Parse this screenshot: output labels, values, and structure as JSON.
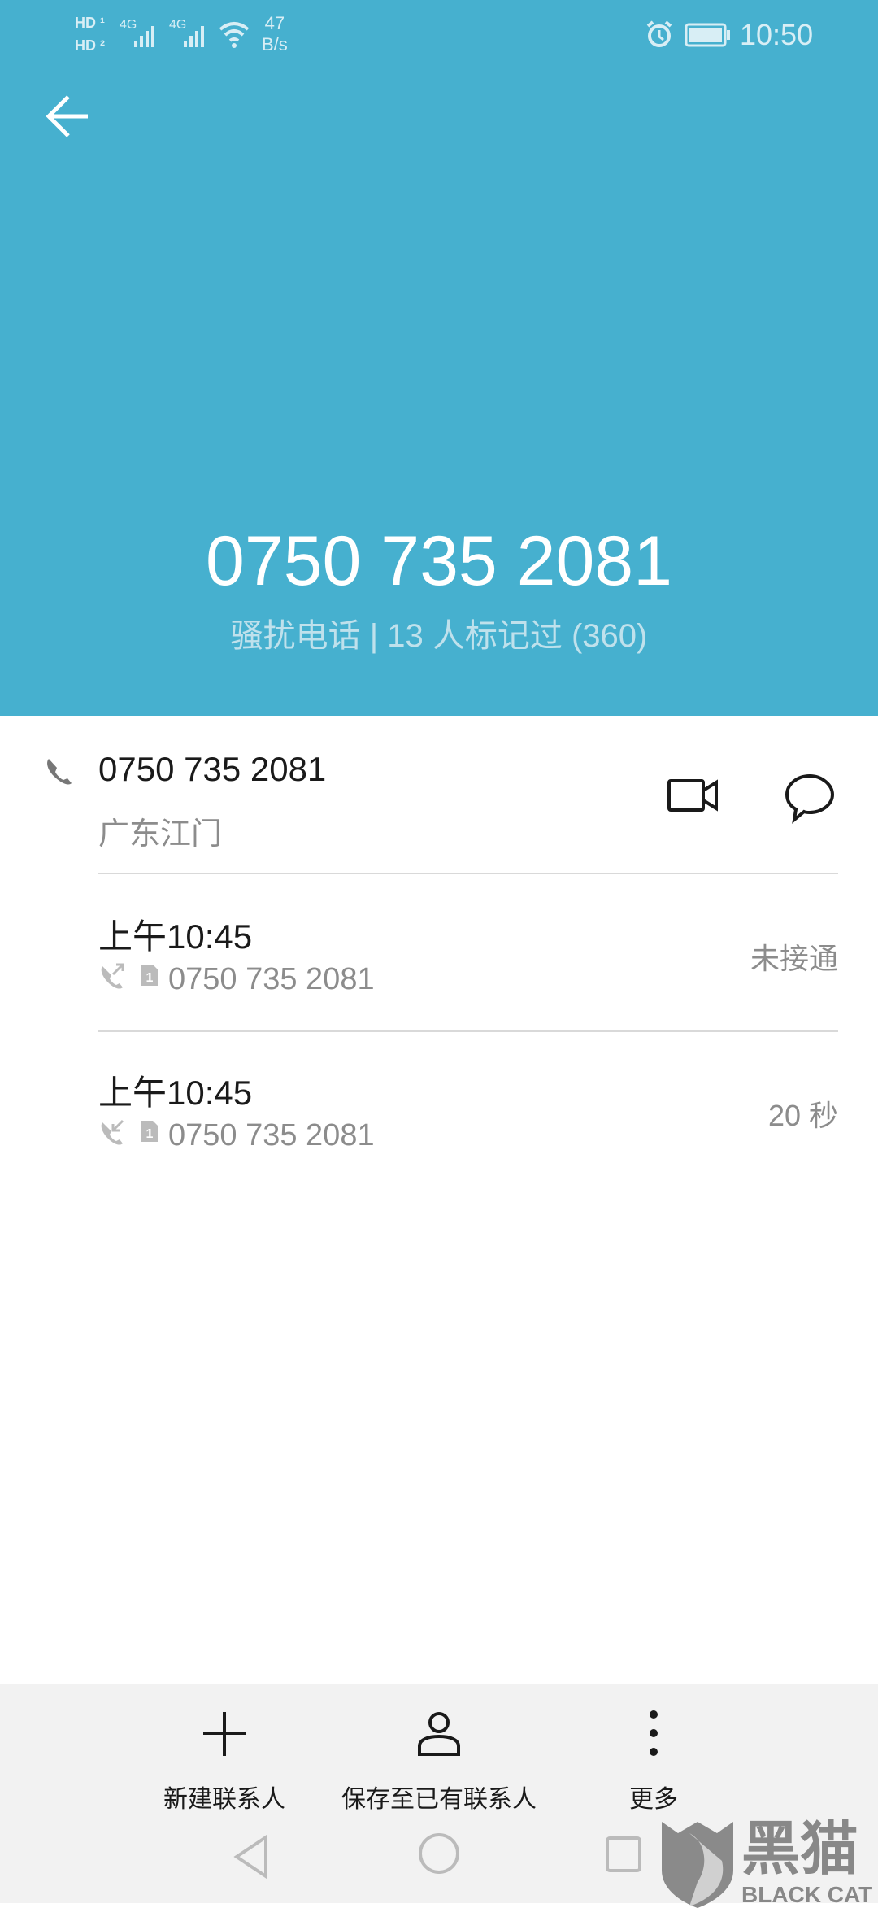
{
  "status_bar": {
    "sim1": "HD",
    "sim2": "HD",
    "network1": "4G",
    "network2": "4G",
    "speed_value": "47",
    "speed_unit": "B/s",
    "time": "10:50",
    "icons": [
      "alarm-icon",
      "battery-icon",
      "wifi-icon",
      "signal-icon"
    ]
  },
  "header": {
    "number": "0750 735 2081",
    "subtitle": "骚扰电话 | 13 人标记过 (360)",
    "color": "#46b0cf"
  },
  "contact": {
    "number": "0750 735 2081",
    "location": "广东江门"
  },
  "calls": [
    {
      "time": "上午10:45",
      "sim": "1",
      "number": "0750 735 2081",
      "status": "未接通",
      "direction": "outgoing"
    },
    {
      "time": "上午10:45",
      "sim": "1",
      "number": "0750 735 2081",
      "status": "20 秒",
      "direction": "incoming"
    }
  ],
  "actions": [
    {
      "label": "新建联系人",
      "icon": "plus-icon"
    },
    {
      "label": "保存至已有联系人",
      "icon": "person-icon"
    },
    {
      "label": "更多",
      "icon": "more-vertical-icon"
    }
  ],
  "watermark": {
    "text_cn": "黑猫",
    "text_en": "BLACK CAT"
  }
}
